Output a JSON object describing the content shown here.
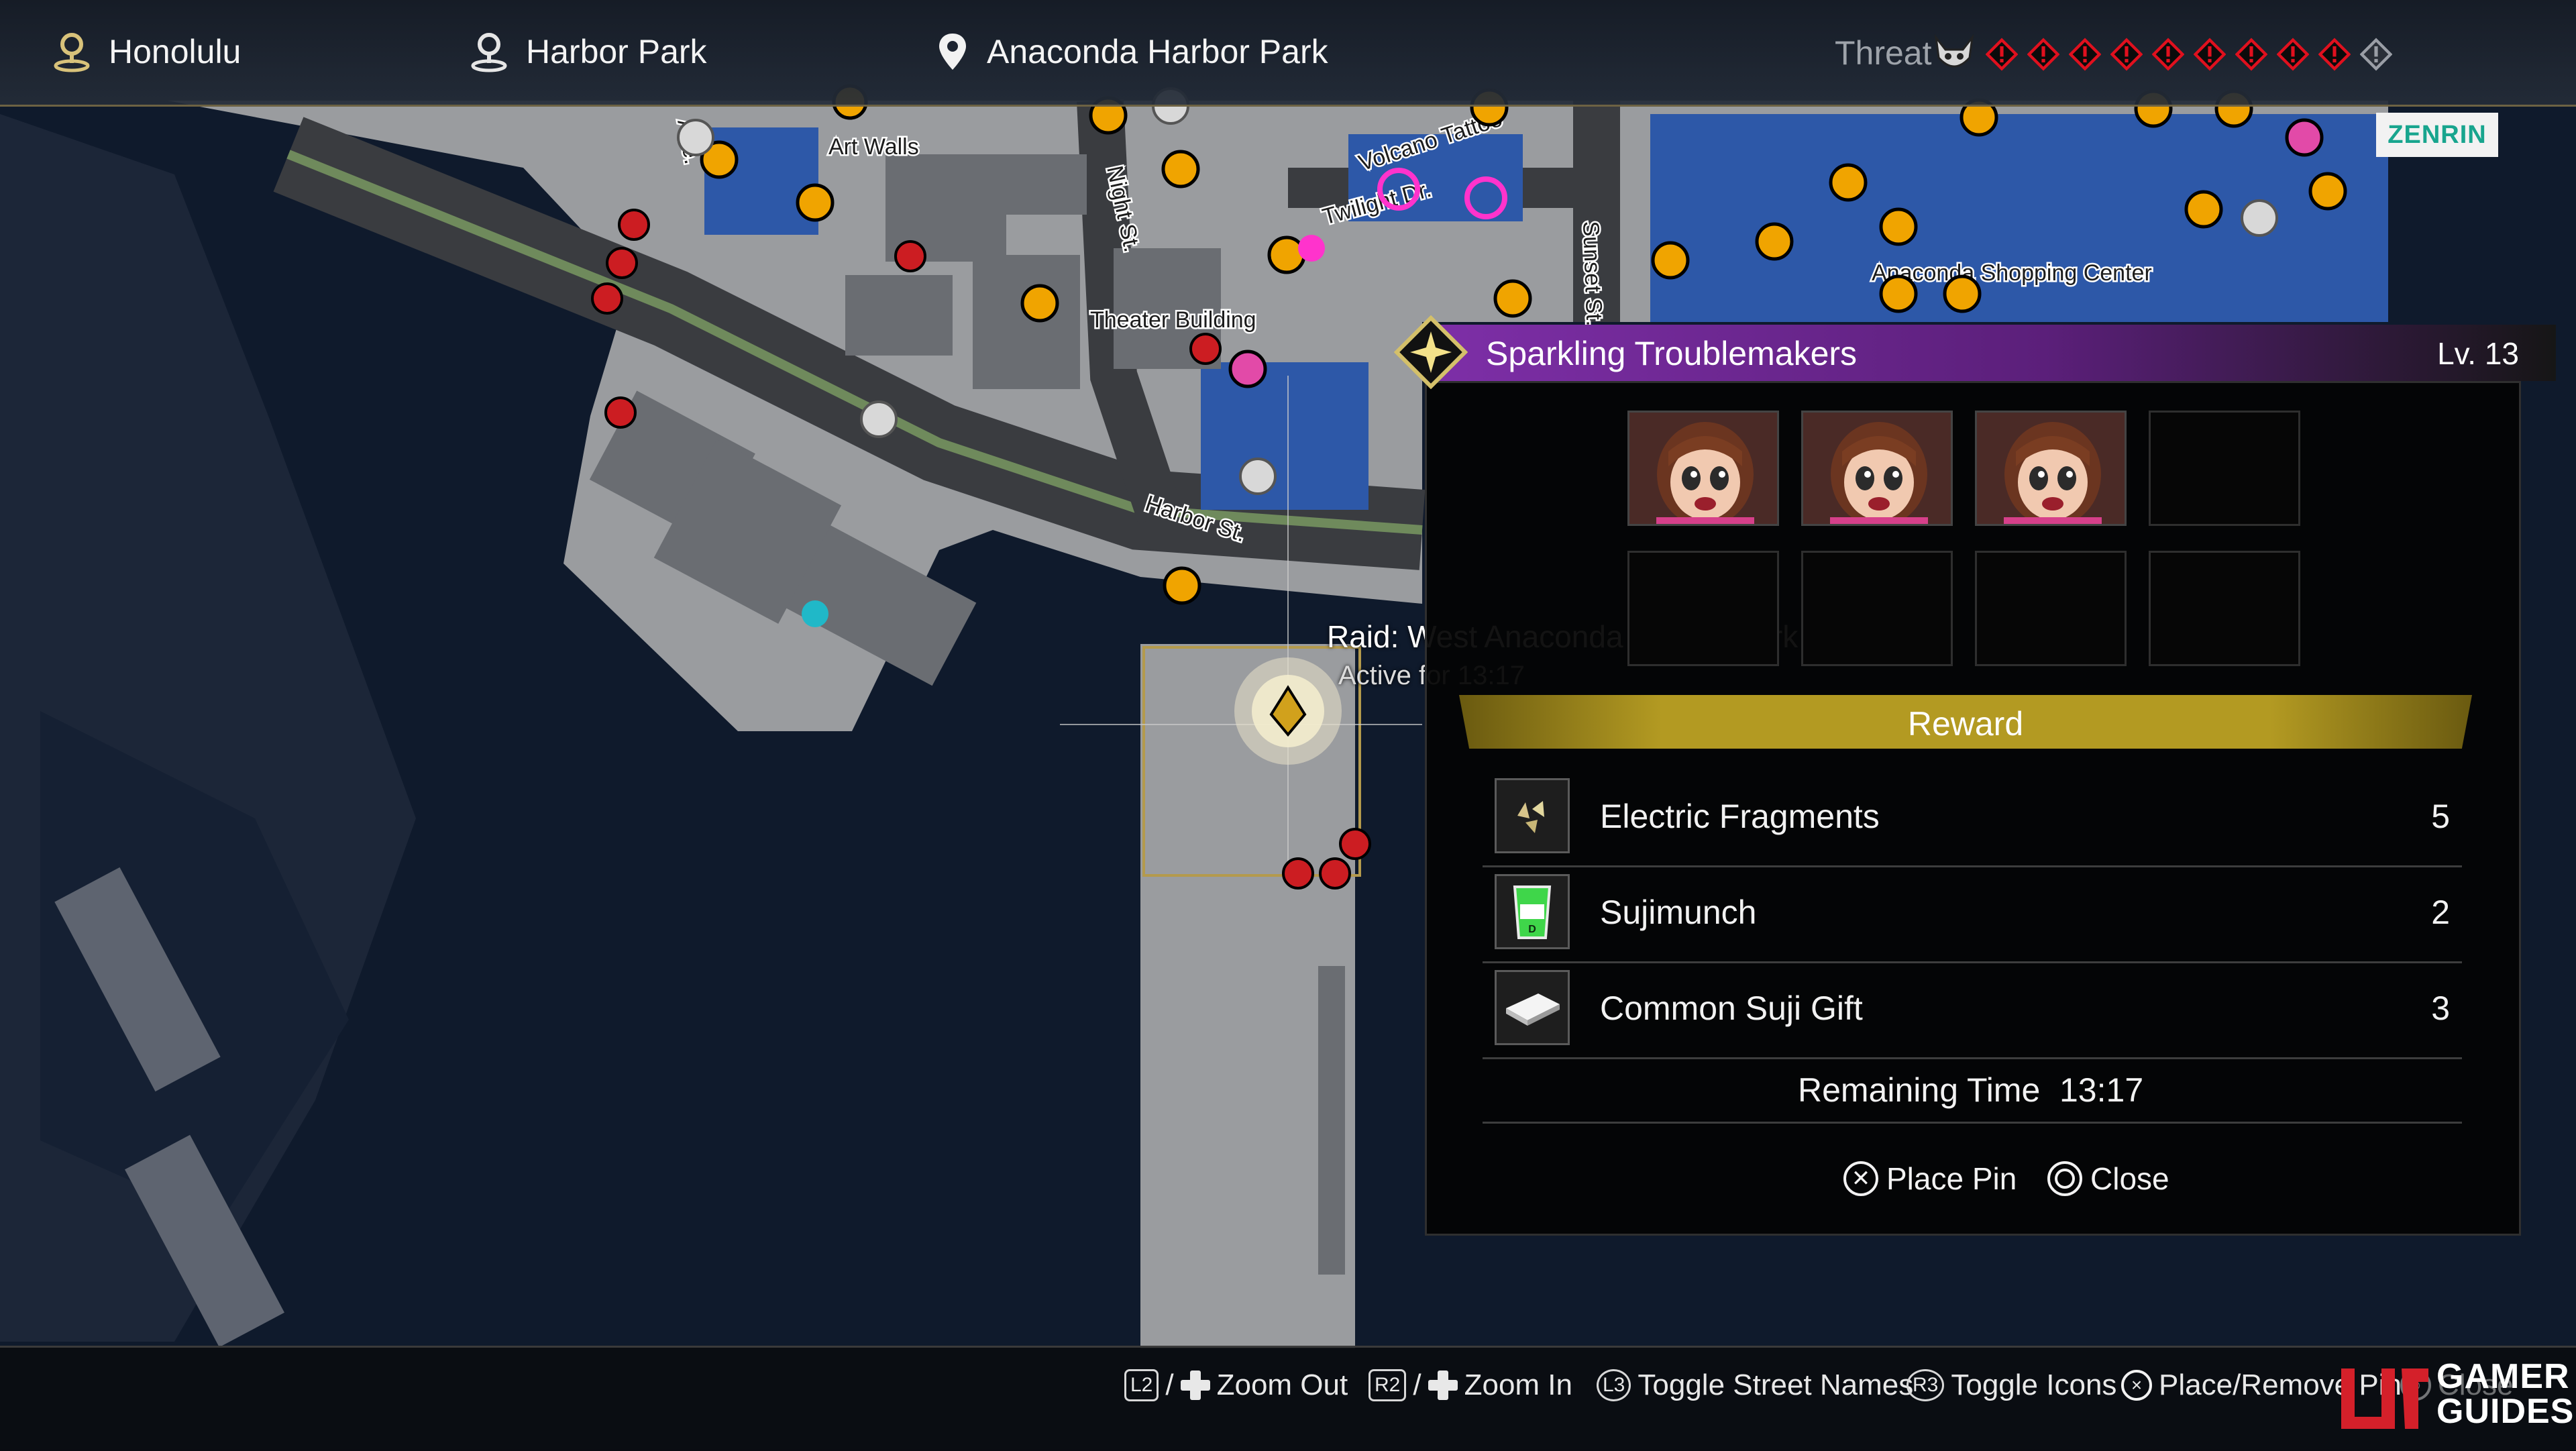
{
  "header": {
    "locations": [
      {
        "label": "Honolulu",
        "icon": "district-pin-icon"
      },
      {
        "label": "Harbor Park",
        "icon": "area-pin-icon"
      },
      {
        "label": "Anaconda Harbor Park",
        "icon": "location-pin-icon"
      }
    ],
    "threat_label": "Threat",
    "threat_level": 9,
    "threat_max": 10,
    "threat_color": "#e0101e"
  },
  "map": {
    "street_labels": [
      "Art Walls",
      "Night St.",
      "Volcano Tattoo",
      "Twilight Dr.",
      "Sunset St.",
      "Theater Building",
      "Anaconda Shopping Center",
      "Harbor St.",
      "Ave."
    ],
    "attribution": "ZENRIN",
    "raid_title": "Raid: West Anaconda Harbor Park",
    "raid_active": "Active for 13:17"
  },
  "panel": {
    "title": "Sparkling Troublemakers",
    "level": "Lv.  13",
    "header_color": "#7e2fa8",
    "enemy_slots": [
      {
        "filled": true,
        "icon": "troublemaker-portrait"
      },
      {
        "filled": true,
        "icon": "troublemaker-portrait"
      },
      {
        "filled": true,
        "icon": "troublemaker-portrait"
      },
      {
        "filled": false
      },
      {
        "filled": false
      },
      {
        "filled": false
      },
      {
        "filled": false
      },
      {
        "filled": false
      }
    ],
    "reward_label": "Reward",
    "rewards": [
      {
        "name": "Electric Fragments",
        "qty": "5",
        "icon": "electric-fragments-icon"
      },
      {
        "name": "Sujimunch",
        "qty": "2",
        "icon": "sujimunch-icon"
      },
      {
        "name": "Common Suji Gift",
        "qty": "3",
        "icon": "suji-gift-icon"
      }
    ],
    "remaining_label": "Remaining Time",
    "remaining_value": "13:17",
    "buttons": {
      "place_pin": "Place Pin",
      "close": "Close"
    }
  },
  "controls": [
    {
      "key": "L2",
      "label": "Zoom Out"
    },
    {
      "key": "R2",
      "label": "Zoom In"
    },
    {
      "key": "L3",
      "label": "Toggle Street Names"
    },
    {
      "key": "R3",
      "label": "Toggle Icons"
    },
    {
      "key": "×",
      "label": "Place/Remove Pin"
    },
    {
      "key": "○",
      "label": "Close"
    }
  ],
  "watermark": {
    "line1": "GAMER",
    "line2": "GUIDES"
  }
}
